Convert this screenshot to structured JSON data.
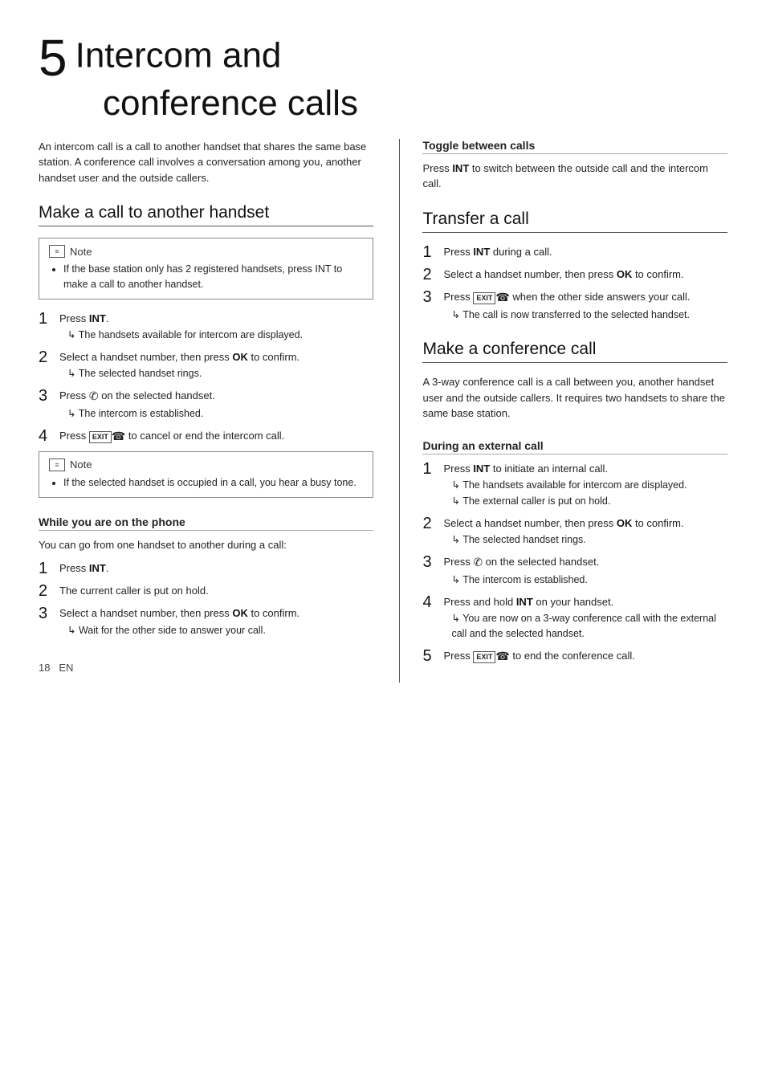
{
  "page": {
    "chapter_num": "5",
    "title_line1": "Intercom and",
    "title_line2": "conference calls",
    "intro": "An intercom call is a call to another handset that shares the same base station. A conference call involves a conversation among you, another handset user and the outside callers.",
    "page_number": "18",
    "lang": "EN"
  },
  "make_call_section": {
    "heading": "Make a call to another handset",
    "note1_title": "Note",
    "note1_bullet": "If the base station only has 2 registered handsets, press INT to make a call to another handset.",
    "steps": [
      {
        "num": "1",
        "text": "Press INT.",
        "result": "The handsets available for intercom are displayed."
      },
      {
        "num": "2",
        "text": "Select a handset number, then press OK to confirm.",
        "result": "The selected handset rings."
      },
      {
        "num": "3",
        "text": "Press [phone] on the selected handset.",
        "result": "The intercom is established."
      },
      {
        "num": "4",
        "text": "Press [exit] to cancel or end the intercom call.",
        "result": null
      }
    ],
    "note2_title": "Note",
    "note2_bullet": "If the selected handset is occupied in a call, you hear a busy tone."
  },
  "while_on_phone_section": {
    "heading": "While you are on the phone",
    "intro": "You can go from one handset to another during a call:",
    "steps": [
      {
        "num": "1",
        "text": "Press INT."
      },
      {
        "num": "2",
        "text": "The current caller is put on hold."
      },
      {
        "num": "3",
        "text": "Select a handset number, then press OK to confirm.",
        "result": "Wait for the other side to answer your call."
      }
    ]
  },
  "toggle_section": {
    "heading": "Toggle between calls",
    "text": "Press INT to switch between the outside call and the intercom call."
  },
  "transfer_section": {
    "heading": "Transfer a call",
    "steps": [
      {
        "num": "1",
        "text": "Press INT during a call."
      },
      {
        "num": "2",
        "text": "Select a handset number, then press OK to confirm."
      },
      {
        "num": "3",
        "text": "Press [exit] when the other side answers your call.",
        "result": "The call is now transferred to the selected handset."
      }
    ]
  },
  "conference_section": {
    "heading": "Make a conference call",
    "intro": "A 3-way conference call is a call between you, another handset user and the outside callers. It requires two handsets to share the same base station.",
    "during_external_heading": "During an external call",
    "steps": [
      {
        "num": "1",
        "text": "Press INT to initiate an internal call.",
        "result": "The handsets available for intercom are displayed.",
        "result2": "The external caller is put on hold."
      },
      {
        "num": "2",
        "text": "Select a handset number, then press OK to confirm.",
        "result": "The selected handset rings."
      },
      {
        "num": "3",
        "text": "Press [phone] on the selected handset.",
        "result": "The intercom is established."
      },
      {
        "num": "4",
        "text": "Press and hold INT on your handset.",
        "result": "You are now on a 3-way conference call with the external call and the selected handset."
      },
      {
        "num": "5",
        "text": "Press [exit] to end the conference call.",
        "result": null
      }
    ]
  }
}
